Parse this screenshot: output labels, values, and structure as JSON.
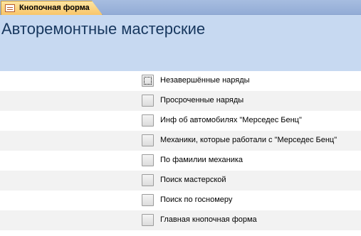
{
  "tab": {
    "label": "Кнопочная форма",
    "icon": "form-icon"
  },
  "header": {
    "title": "Авторемонтные мастерские",
    "background": "#c7d9f1",
    "title_color": "#17375e"
  },
  "items": [
    {
      "label": "Незавершённые наряды"
    },
    {
      "label": "Просроченные наряды"
    },
    {
      "label": "Инф об автомобилях \"Мерседес Бенц\""
    },
    {
      "label": "Механики, которые работали с \"Мерседес Бенц\""
    },
    {
      "label": "По фамилии механика"
    },
    {
      "label": "Поиск мастерской"
    },
    {
      "label": "Поиск по госномеру"
    },
    {
      "label": "Главная кнопочная форма"
    }
  ]
}
